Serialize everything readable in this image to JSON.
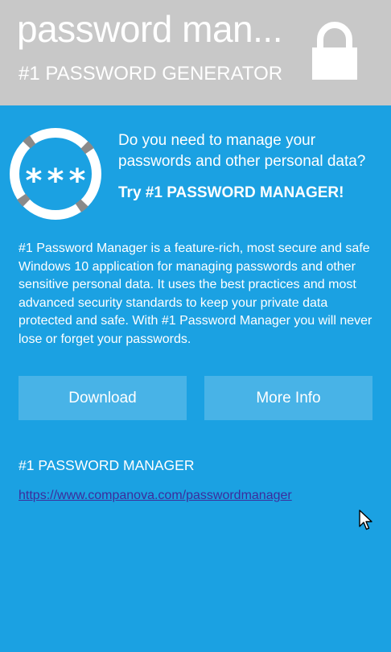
{
  "header": {
    "app_title": "password man...",
    "subtitle": "#1 PASSWORD GENERATOR",
    "lock_icon": "lock-icon",
    "background_color": "#c8c8c8"
  },
  "promo": {
    "logo_icon": "password-asterisks-logo",
    "question": "Do you need to manage your passwords and other personal data?",
    "tagline": "Try #1 PASSWORD MANAGER!",
    "description": "#1 Password Manager is a feature-rich, most secure and safe Windows 10 application for managing passwords and other sensitive personal data. It uses the best practices and most advanced security standards to keep your private data protected and safe. With #1 Password Manager you will never lose or forget your passwords."
  },
  "buttons": {
    "download_label": "Download",
    "more_info_label": "More Info"
  },
  "footer": {
    "section_title": "#1 PASSWORD MANAGER",
    "link_text": "https://www.companova.com/passwordmanager"
  },
  "colors": {
    "accent": "#1ba1e2",
    "link": "#3c2d9c"
  }
}
